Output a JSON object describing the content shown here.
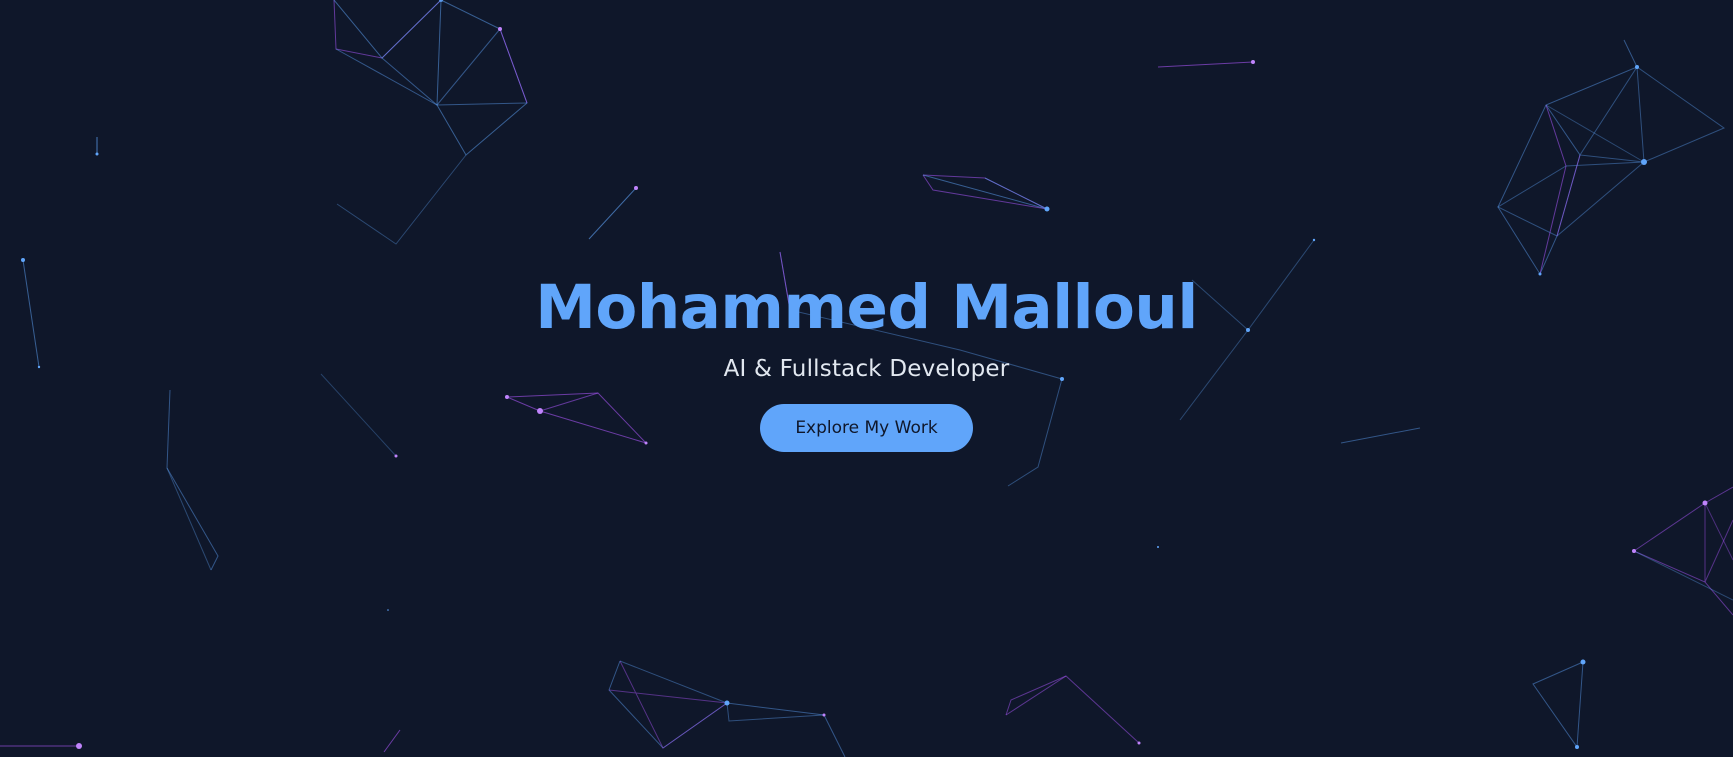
{
  "hero": {
    "title": "Mohammed Malloul",
    "subtitle": "AI & Fullstack Developer",
    "cta_label": "Explore My Work"
  },
  "colors": {
    "background": "#0f172a",
    "accent": "#60a5fa",
    "secondary_accent": "#c084fc",
    "text": "#e2e8f0"
  }
}
